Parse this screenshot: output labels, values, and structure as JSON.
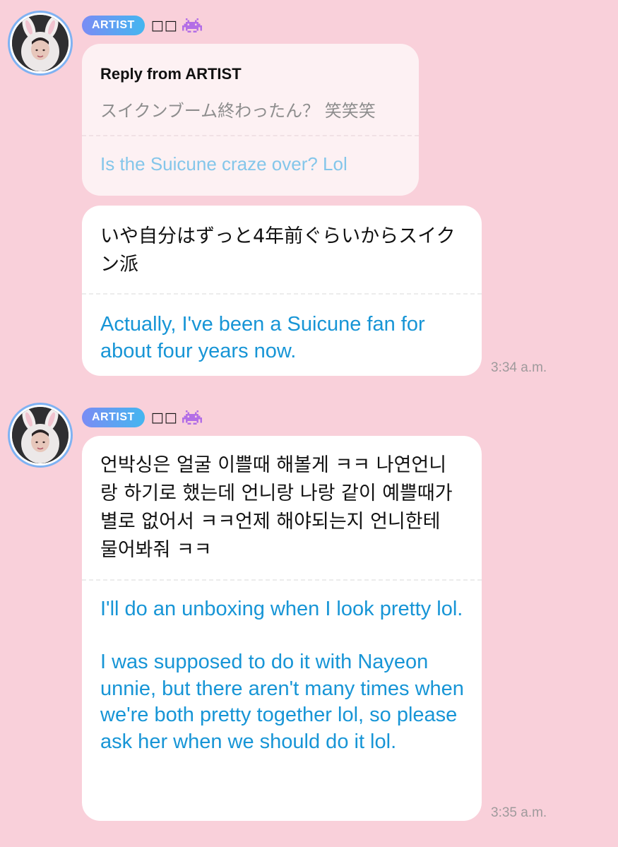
{
  "theme": {
    "background": "#f9d0da",
    "badge_gradient": [
      "#7a8cf4",
      "#44b6f0"
    ],
    "translation_color": "#1795d6",
    "reply_translation_color": "#84c6ea"
  },
  "messages": [
    {
      "sender": {
        "badge": "ARTIST",
        "name": "□□",
        "emoji_icon": "space-invader-icon",
        "avatar": "avatar-white-bunny-costume"
      },
      "reply": {
        "header": "Reply from ARTIST",
        "original": "スイクンブーム終わったん？ 笑笑笑",
        "translation": "Is the Suicune craze over? Lol"
      },
      "original": "いや自分はずっと4年前ぐらいからスイクン派",
      "translation": [
        "Actually, I've been a Suicune fan for about four years now."
      ],
      "time": "3:34 a.m."
    },
    {
      "sender": {
        "badge": "ARTIST",
        "name": "□□",
        "emoji_icon": "space-invader-icon",
        "avatar": "avatar-white-bunny-costume"
      },
      "original": "언박싱은 얼굴 이쁠때 해볼게 ㅋㅋ 나연언니랑 하기로 했는데 언니랑 나랑 같이 예쁠때가 별로 없어서 ㅋㅋ언제 해야되는지 언니한테 물어봐줘 ㅋㅋ",
      "translation": [
        "I'll do an unboxing when I look pretty lol.",
        "I was supposed to do it with Nayeon unnie, but there aren't many times when we're both pretty together lol, so please ask her when we should do it lol."
      ],
      "time": "3:35 a.m."
    }
  ]
}
